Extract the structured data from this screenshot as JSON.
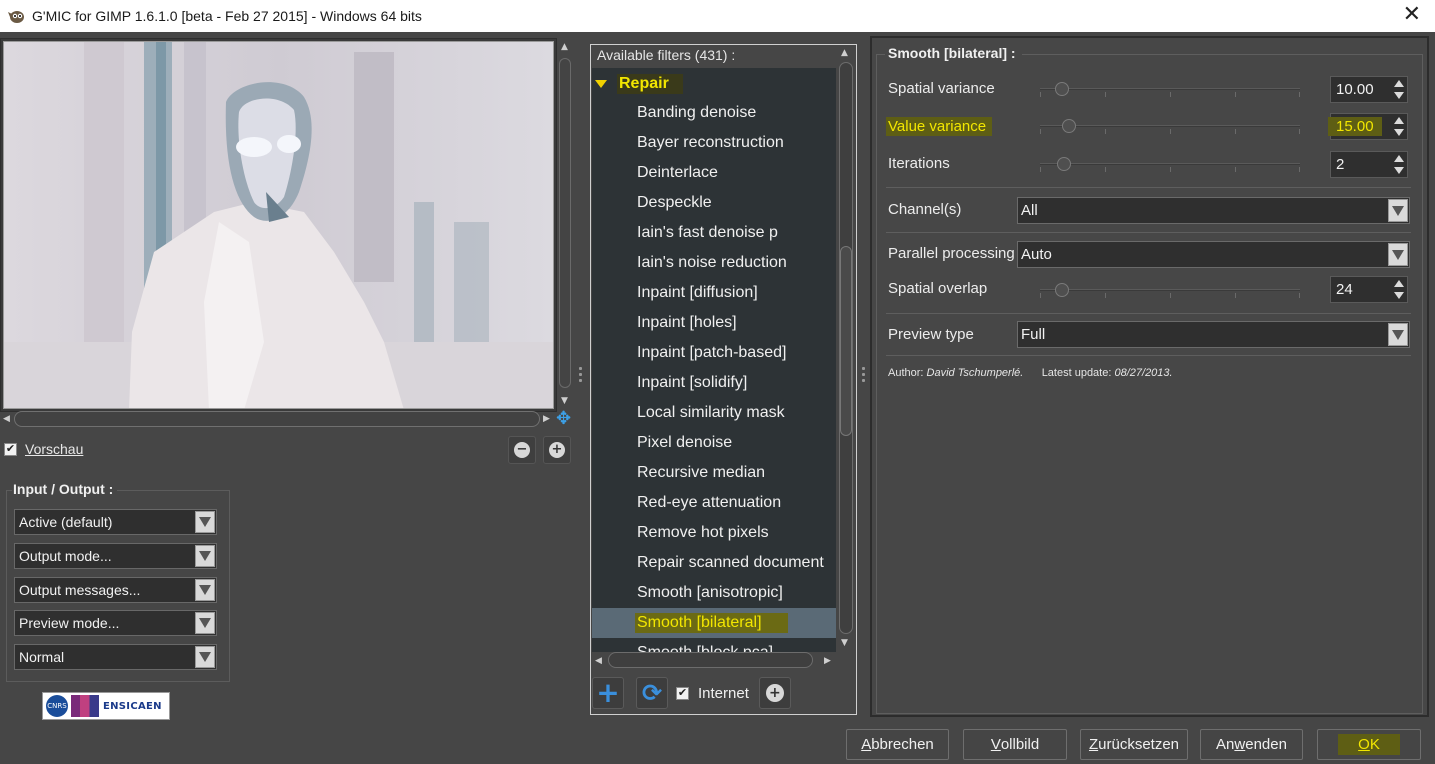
{
  "window": {
    "title": "G'MIC for GIMP 1.6.1.0 [beta - Feb 27 2015] - Windows 64 bits",
    "close_glyph": "✕"
  },
  "preview": {
    "checkbox_label": "Vorschau",
    "checkbox_checked": true
  },
  "io": {
    "title": "Input / Output :",
    "selects": [
      "Active (default)",
      "Output mode...",
      "Output messages...",
      "Preview mode...",
      "Normal"
    ]
  },
  "logo": {
    "cnrs": "CNRS",
    "ensicaen": "ENSICAEN"
  },
  "filters": {
    "header": "Available filters (431) :",
    "category": "Repair",
    "items": [
      "Banding denoise",
      "Bayer reconstruction",
      "Deinterlace",
      "Despeckle",
      "Iain's fast denoise p",
      "Iain's noise reduction",
      "Inpaint [diffusion]",
      "Inpaint [holes]",
      "Inpaint [patch-based]",
      "Inpaint [solidify]",
      "Local similarity mask",
      "Pixel denoise",
      "Recursive median",
      "Red-eye attenuation",
      "Remove hot pixels",
      "Repair scanned document",
      "Smooth [anisotropic]",
      "Smooth [bilateral]",
      "Smooth [block pca]"
    ],
    "selected": "Smooth [bilateral]",
    "internet_label": "Internet",
    "internet_checked": true
  },
  "params": {
    "title": "Smooth [bilateral] :",
    "spatial_variance": {
      "label": "Spatial variance",
      "value": "10.00",
      "slider_fraction": 0.06
    },
    "value_variance": {
      "label": "Value variance",
      "value": "15.00",
      "slider_fraction": 0.09
    },
    "iterations": {
      "label": "Iterations",
      "value": "2",
      "slider_fraction": 0.07
    },
    "channels": {
      "label": "Channel(s)",
      "value": "All"
    },
    "parallel": {
      "label": "Parallel processing",
      "value": "Auto"
    },
    "overlap": {
      "label": "Spatial overlap",
      "value": "24",
      "slider_fraction": 0.06
    },
    "preview_type": {
      "label": "Preview type",
      "value": "Full"
    },
    "author_label": "Author:",
    "author_name": "David Tschumperlé.",
    "update_label": "Latest update:",
    "update_date": "08/27/2013."
  },
  "buttons": {
    "cancel": {
      "pre": "",
      "u": "A",
      "post": "bbrechen"
    },
    "fullscreen": {
      "pre": "",
      "u": "V",
      "post": "ollbild"
    },
    "reset": {
      "pre": "",
      "u": "Z",
      "post": "urücksetzen"
    },
    "apply": {
      "pre": "An",
      "u": "w",
      "post": "enden"
    },
    "ok": {
      "pre": "",
      "u": "O",
      "post": "K"
    }
  },
  "colors": {
    "highlight_text": "#f2e600",
    "highlight_bg": "#5e5e14",
    "selection_bg": "#5a6a76",
    "accent_blue": "#3a8fdc"
  }
}
